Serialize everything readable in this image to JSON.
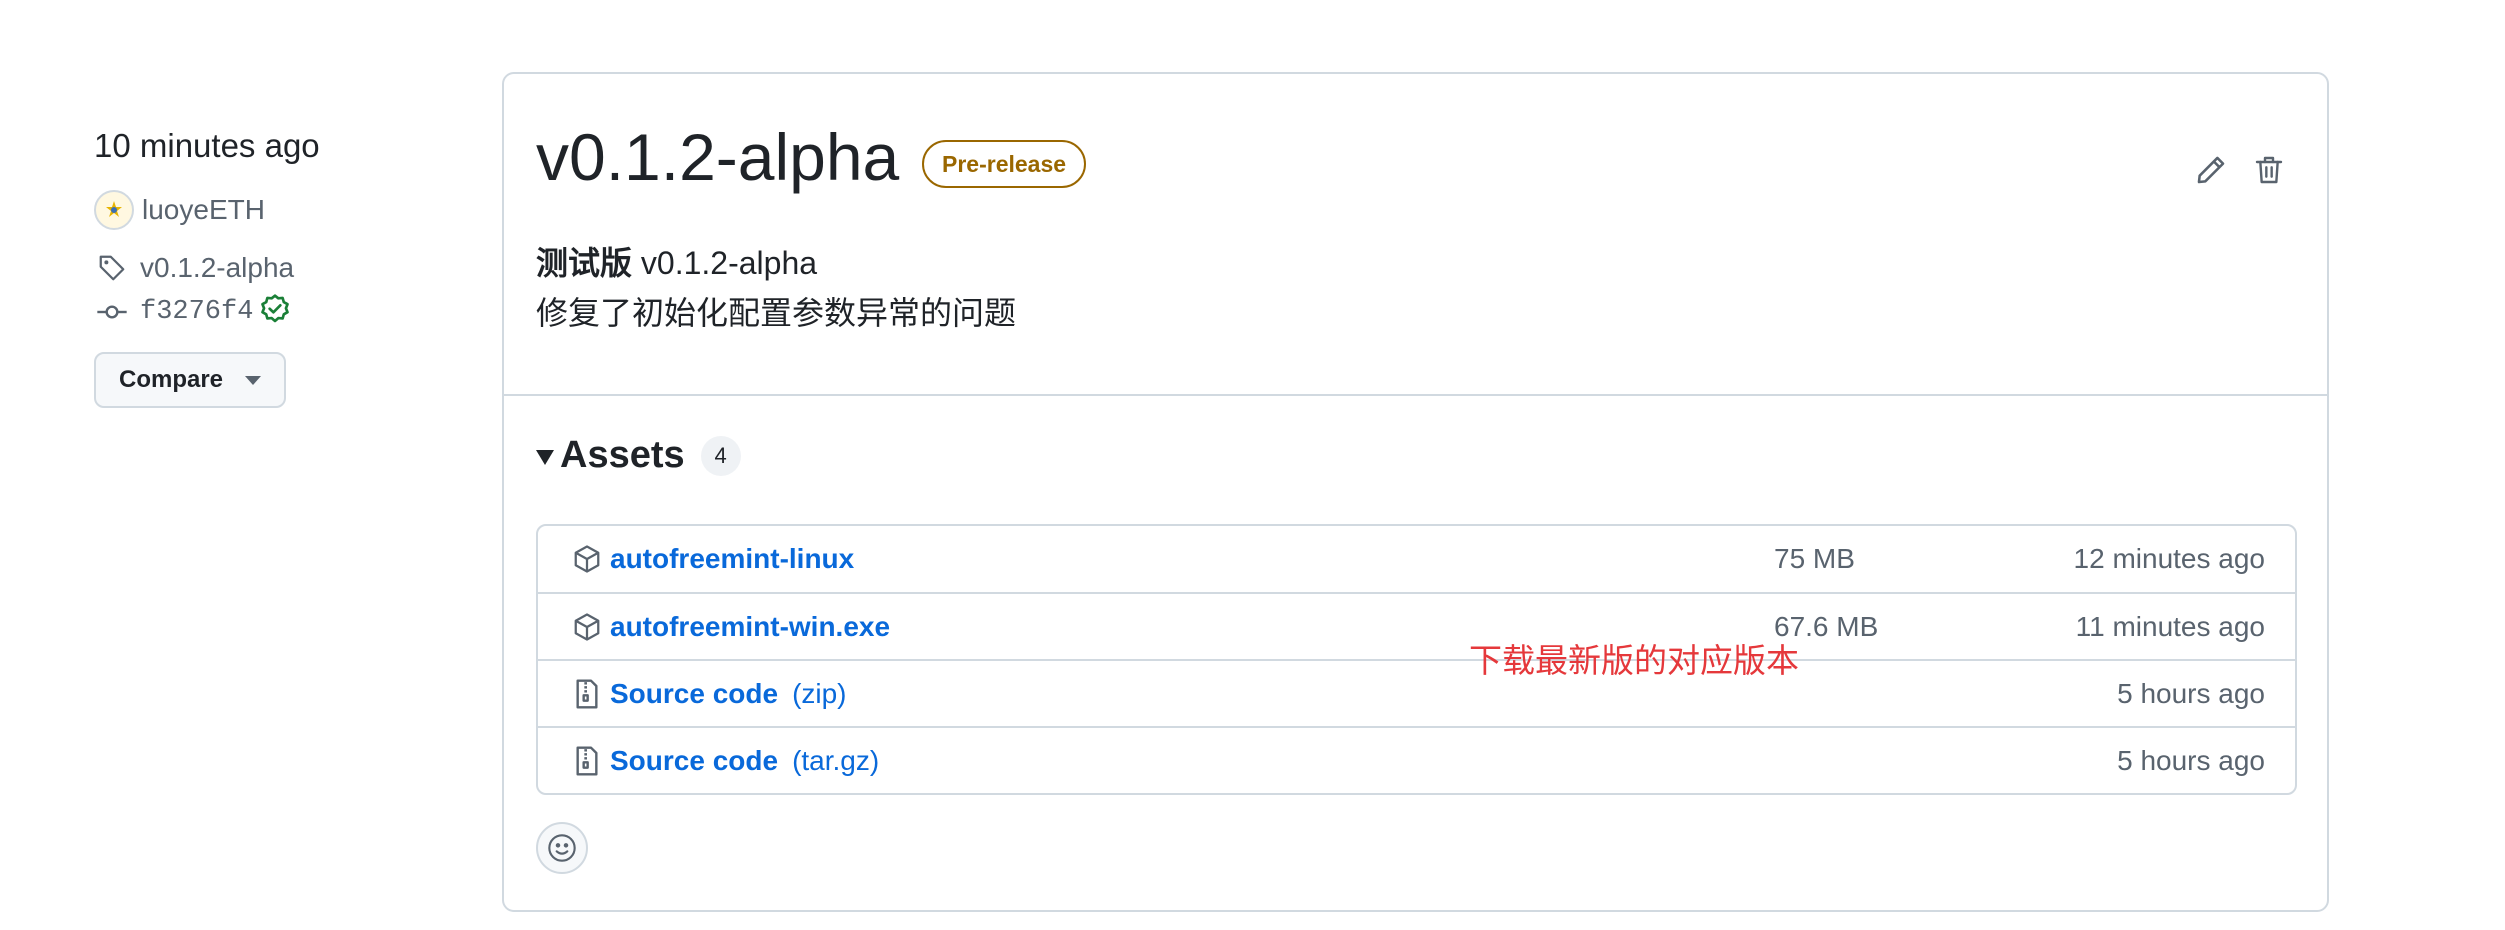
{
  "meta": {
    "time": "10 minutes ago",
    "author": "luoyeETH",
    "tag": "v0.1.2-alpha",
    "commit": "f3276f4",
    "compare_label": "Compare"
  },
  "release": {
    "title": "v0.1.2-alpha",
    "badge": "Pre-release",
    "notes_bold": "测试版",
    "notes_version": "v0.1.2-alpha",
    "notes_body": "修复了初始化配置参数异常的问题"
  },
  "assets": {
    "label": "Assets",
    "count": "4",
    "items": [
      {
        "name": "autofreemint-linux",
        "format": "",
        "size": "75 MB",
        "time": "12 minutes ago",
        "icon": "package-icon"
      },
      {
        "name": "autofreemint-win.exe",
        "format": "",
        "size": "67.6 MB",
        "time": "11 minutes ago",
        "icon": "package-icon"
      },
      {
        "name": "Source code",
        "format": "(zip)",
        "size": "",
        "time": "5 hours ago",
        "icon": "file-zip-icon"
      },
      {
        "name": "Source code",
        "format": "(tar.gz)",
        "size": "",
        "time": "5 hours ago",
        "icon": "file-zip-icon"
      }
    ],
    "annotation": "下载最新版的对应版本"
  },
  "colors": {
    "link": "#0969da",
    "muted": "#59636e",
    "border": "#d1d9e0",
    "prerelease": "#9a6700",
    "annotation": "#e5383b",
    "verified": "#1a7f37"
  }
}
